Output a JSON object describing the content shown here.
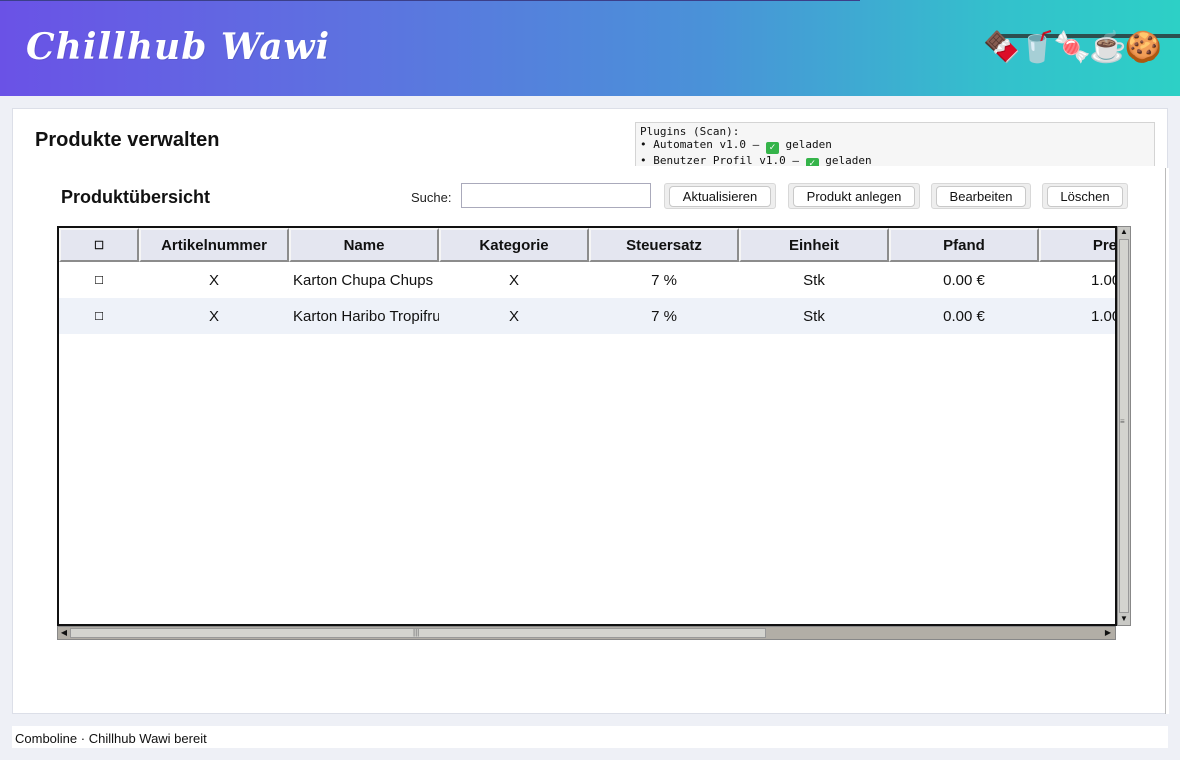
{
  "header": {
    "title": "Chillhub Wawi",
    "emojis": "🍫🥤🍬☕🍪"
  },
  "page": {
    "title": "Produkte verwalten"
  },
  "plugins": {
    "heading": "Plugins (Scan):",
    "items": [
      {
        "bullet": "•",
        "name": "Automaten v1.0 –",
        "status": "geladen"
      },
      {
        "bullet": "•",
        "name": "Benutzer Profil v1.0 –",
        "status": "geladen"
      }
    ],
    "check_glyph": "✓"
  },
  "overview": {
    "title": "Produktübersicht",
    "search_label": "Suche:",
    "search_value": "",
    "buttons": {
      "refresh": "Aktualisieren",
      "create": "Produkt anlegen",
      "edit": "Bearbeiten",
      "delete": "Löschen"
    }
  },
  "table": {
    "columns": [
      "☐",
      "Artikelnummer",
      "Name",
      "Kategorie",
      "Steuersatz",
      "Einheit",
      "Pfand",
      "Pre"
    ],
    "rows": [
      [
        "☐",
        "X",
        "Karton Chupa Chups",
        "X",
        "7 %",
        "Stk",
        "0.00 €",
        "1.00"
      ],
      [
        "☐",
        "X",
        "Karton Haribo Tropifrutti",
        "X",
        "7 %",
        "Stk",
        "0.00 €",
        "1.00"
      ]
    ]
  },
  "scroll": {
    "up": "▲",
    "down": "▼",
    "left": "◀",
    "right": "▶",
    "grip_v": "≡",
    "grip_h": "|||"
  },
  "status": {
    "text": "Comboline · Chillhub Wawi bereit"
  },
  "colors": {
    "header_start": "#6a52e6",
    "header_end": "#2dd0c6",
    "row_alt": "#eef2f9",
    "header_cell": "#e4e6f0",
    "check_green": "#35b44a"
  }
}
